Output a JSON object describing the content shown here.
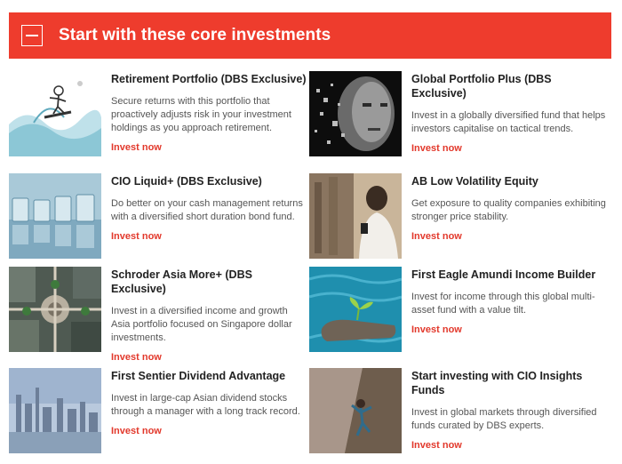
{
  "header": {
    "title": "Start with these core investments"
  },
  "cards": [
    {
      "title": "Retirement Portfolio (DBS Exclusive)",
      "desc": "Secure returns with this portfolio that proactively adjusts risk in your investment holdings as you approach retirement.",
      "link": "Invest now"
    },
    {
      "title": "Global Portfolio Plus (DBS Exclusive)",
      "desc": "Invest in a globally diversified fund that helps investors capitalise on tactical trends.",
      "link": "Invest now"
    },
    {
      "title": "CIO Liquid+ (DBS Exclusive)",
      "desc": "Do better on your cash management returns with a diversified short duration bond fund.",
      "link": "Invest now"
    },
    {
      "title": "AB Low Volatility Equity",
      "desc": "Get exposure to quality companies exhibiting stronger price stability.",
      "link": "Invest now"
    },
    {
      "title": "Schroder Asia More+ (DBS Exclusive)",
      "desc": "Invest in a diversified income and growth Asia portfolio focused on Singapore dollar investments.",
      "link": "Invest now"
    },
    {
      "title": "First Eagle Amundi Income Builder",
      "desc": "Invest for income through this global multi-asset fund with a value tilt.",
      "link": "Invest now"
    },
    {
      "title": "First Sentier Dividend Advantage",
      "desc": "Invest in large-cap Asian dividend stocks through a manager with a long track record.",
      "link": "Invest now"
    },
    {
      "title": "Start investing with CIO Insights Funds",
      "desc": "Invest in global markets through diversified funds curated by DBS experts.",
      "link": "Invest now"
    }
  ]
}
